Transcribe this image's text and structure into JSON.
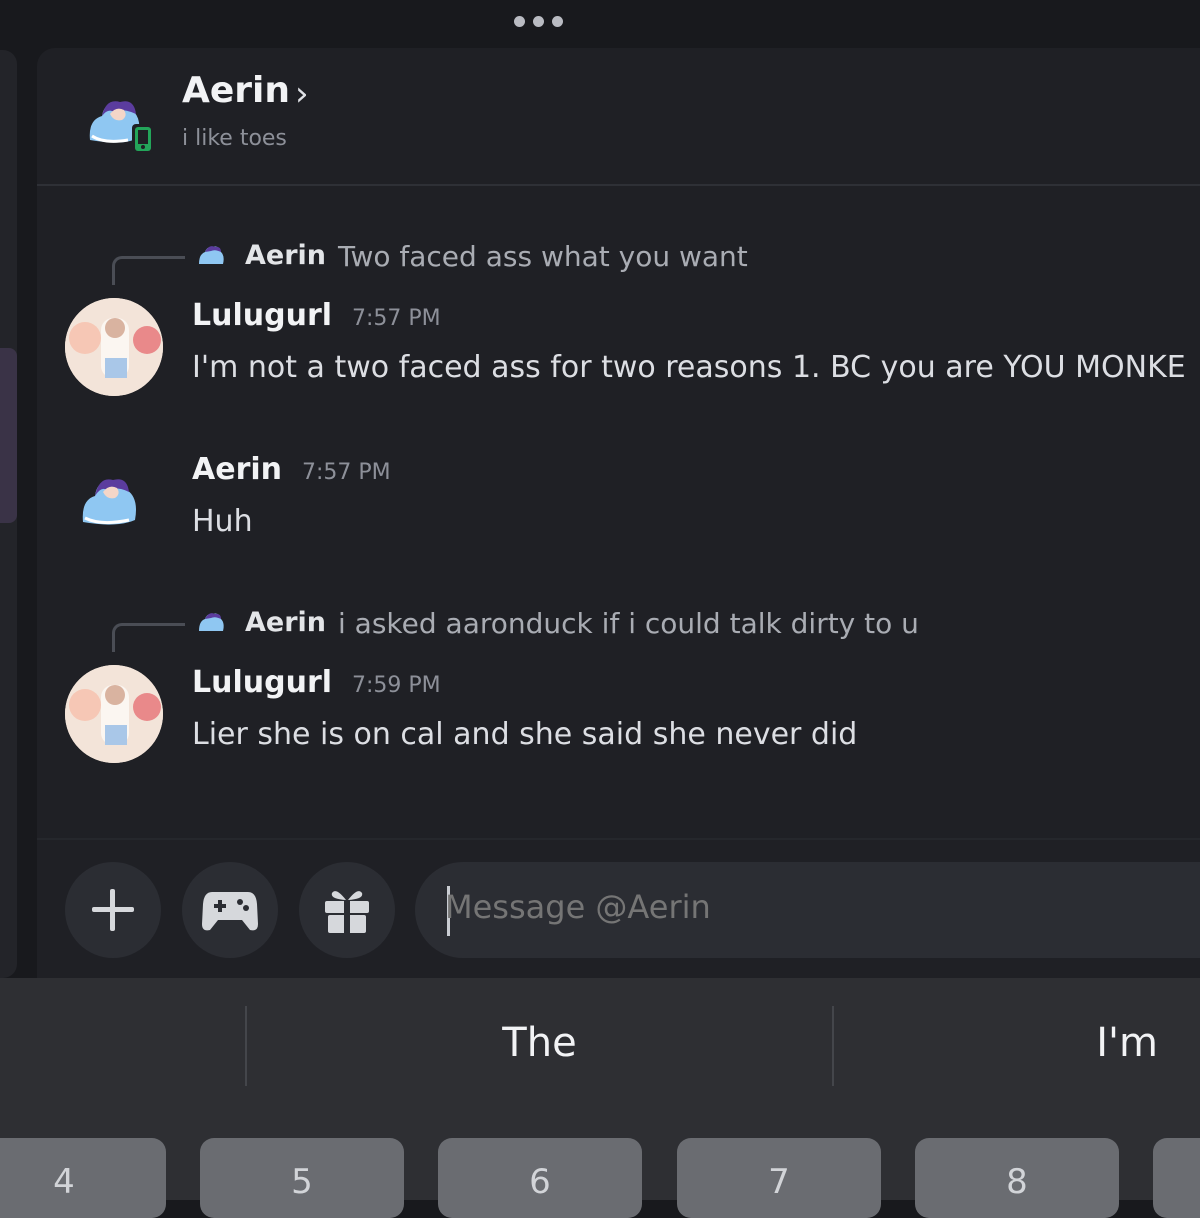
{
  "header": {
    "name": "Aerin",
    "status": "i like toes",
    "chevron": "›"
  },
  "messages": [
    {
      "reply_to": {
        "author": "Aerin",
        "text": "Two faced ass what you want"
      },
      "author": "Lulugurl",
      "time": "7:57 PM",
      "text": "I'm not a two faced ass for two reasons 1. BC you are YOU MONKE"
    },
    {
      "author": "Aerin",
      "time": "7:57 PM",
      "text": "Huh"
    },
    {
      "reply_to": {
        "author": "Aerin",
        "text": "i asked aaronduck if i could talk dirty to u"
      },
      "author": "Lulugurl",
      "time": "7:59 PM",
      "text": "Lier she is on cal and she said she never did"
    }
  ],
  "composer": {
    "placeholder": "Message @Aerin",
    "buttons": [
      "plus-icon",
      "gamepad-icon",
      "gift-icon"
    ]
  },
  "keyboard": {
    "suggestions": [
      "",
      "The",
      "I'm"
    ],
    "keys": [
      "4",
      "5",
      "6",
      "7",
      "8"
    ]
  },
  "colors": {
    "background": "#18191d",
    "panel": "#1f2025",
    "online_green": "#23a55a",
    "keyboard": "#2e2f33"
  }
}
